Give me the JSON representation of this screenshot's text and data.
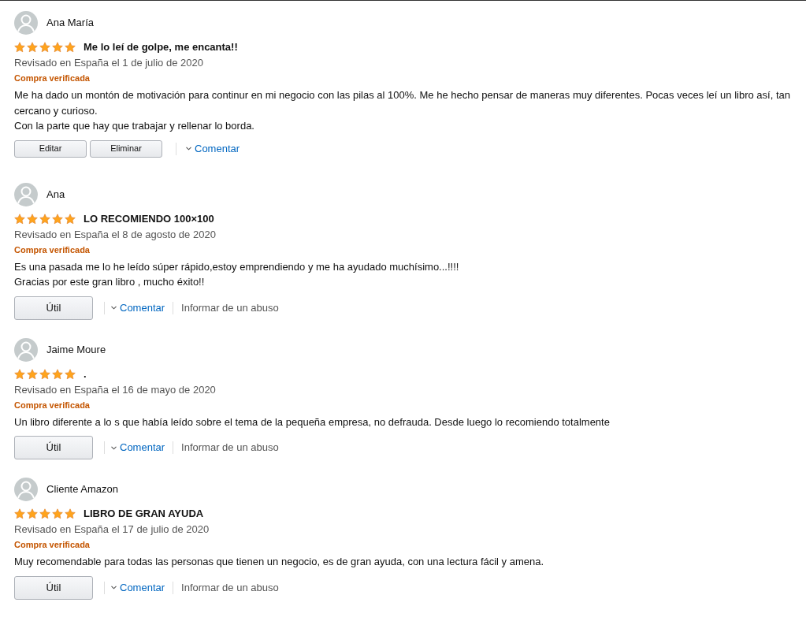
{
  "reviews": [
    {
      "name": "Ana María",
      "stars": 5,
      "title": "Me lo leí de golpe, me encanta!!",
      "date": "Revisado en España el 1 de julio de 2020",
      "verified": "Compra verificada",
      "paragraphs": [
        "Me ha dado un montón de motivación para continur en mi negocio con las pilas al 100%. Me he hecho pensar de maneras muy diferentes. Pocas veces leí un libro así, tan cercano y curioso.",
        "Con la parte que hay que trabajar y rellenar lo borda."
      ],
      "actions": [
        {
          "kind": "small-button",
          "label": "Editar"
        },
        {
          "kind": "small-button",
          "label": "Eliminar"
        },
        {
          "kind": "comment-link",
          "label": "Comentar"
        }
      ]
    },
    {
      "name": "Ana",
      "stars": 5,
      "title": "LO RECOMIENDO 100×100",
      "date": "Revisado en España el 8 de agosto de 2020",
      "verified": "Compra verificada",
      "paragraphs": [
        "Es una pasada me lo he leído súper rápido,estoy emprendiendo y me ha ayudado muchísimo...!!!!",
        "Gracias por este gran libro , mucho éxito!!"
      ],
      "actions": [
        {
          "kind": "helpful-button",
          "label": "Útil"
        },
        {
          "kind": "comment-link",
          "label": "Comentar"
        },
        {
          "kind": "report-link",
          "label": "Informar de un abuso"
        }
      ]
    },
    {
      "name": "Jaime Moure",
      "stars": 5,
      "title": ".",
      "date": "Revisado en España el 16 de mayo de 2020",
      "verified": "Compra verificada",
      "paragraphs": [
        "Un libro diferente a lo s que había leído sobre el tema de la pequeña empresa, no defrauda. Desde luego lo recomiendo totalmente"
      ],
      "actions": [
        {
          "kind": "helpful-button",
          "label": "Útil"
        },
        {
          "kind": "comment-link",
          "label": "Comentar"
        },
        {
          "kind": "report-link",
          "label": "Informar de un abuso"
        }
      ]
    },
    {
      "name": "Cliente Amazon",
      "stars": 5,
      "title": "LIBRO DE GRAN AYUDA",
      "date": "Revisado en España el 17 de julio de 2020",
      "verified": "Compra verificada",
      "paragraphs": [
        "Muy recomendable para todas las personas que tienen un negocio, es de gran ayuda, con una lectura fácil y amena."
      ],
      "actions": [
        {
          "kind": "helpful-button",
          "label": "Útil"
        },
        {
          "kind": "comment-link",
          "label": "Comentar"
        },
        {
          "kind": "report-link",
          "label": "Informar de un abuso"
        }
      ]
    }
  ]
}
